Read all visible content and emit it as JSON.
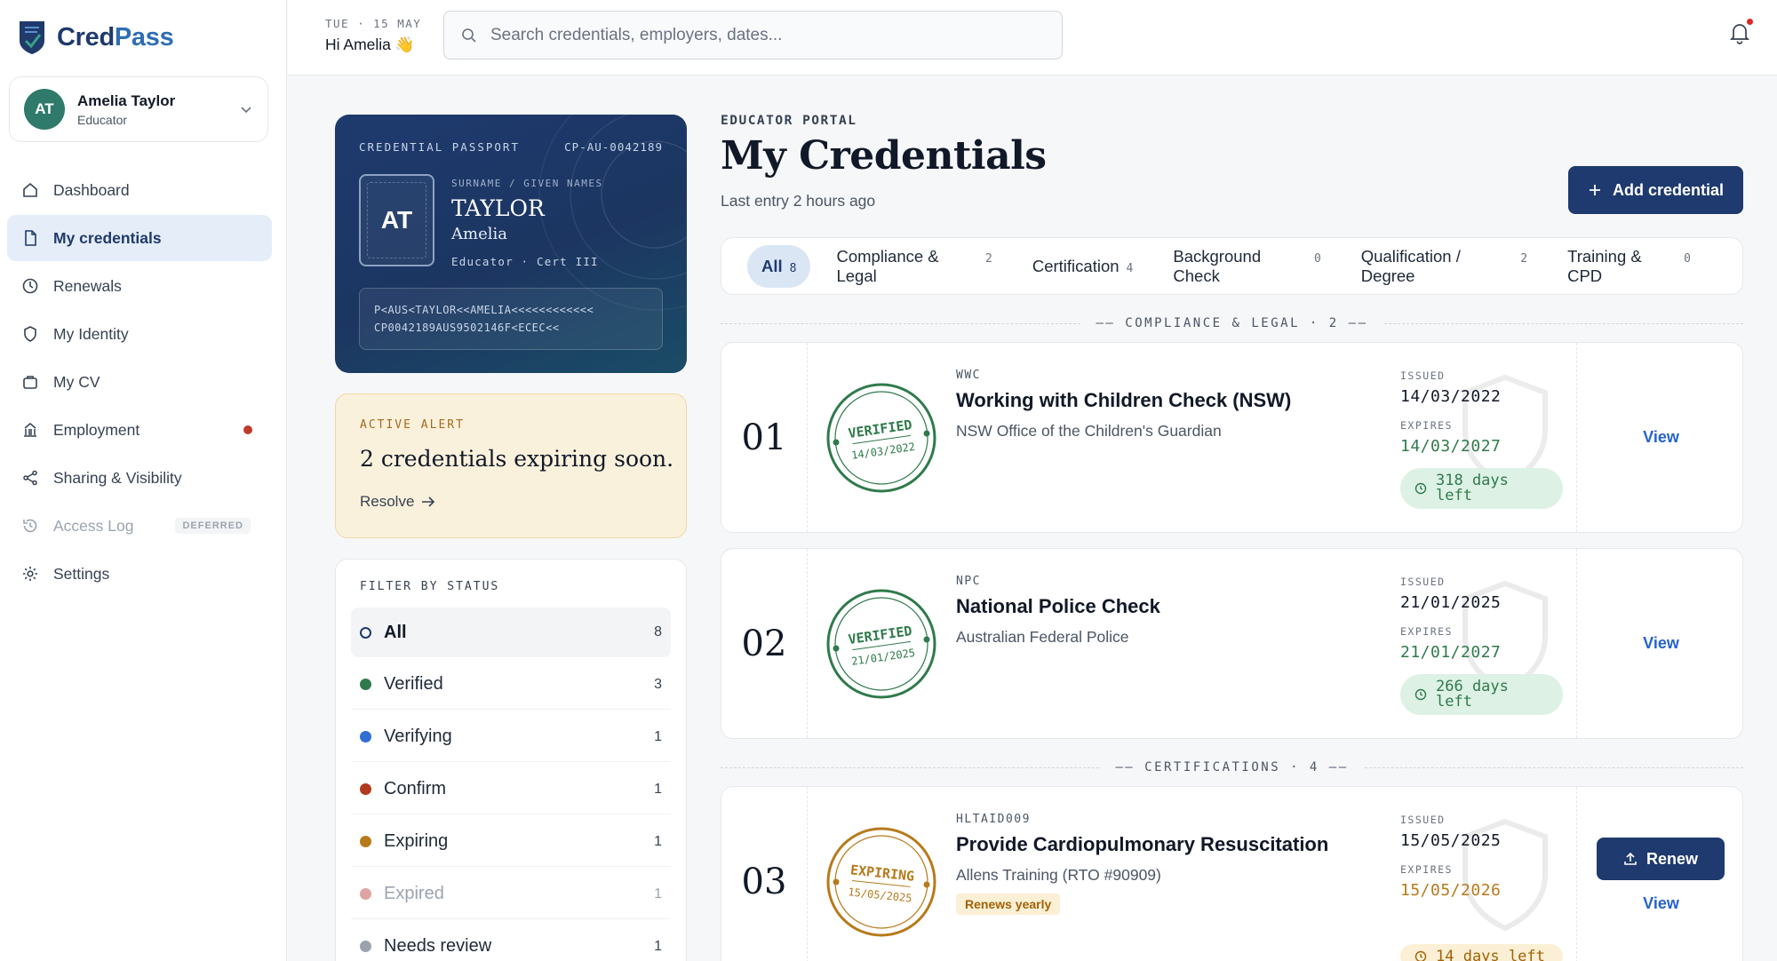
{
  "brand": {
    "name_a": "Cred",
    "name_b": "Pass"
  },
  "user": {
    "initials": "AT",
    "name": "Amelia Taylor",
    "role": "Educator"
  },
  "nav": {
    "dashboard": "Dashboard",
    "credentials": "My credentials",
    "renewals": "Renewals",
    "identity": "My Identity",
    "cv": "My CV",
    "employment": "Employment",
    "sharing": "Sharing & Visibility",
    "access_log": "Access Log",
    "deferred": "DEFERRED",
    "settings": "Settings"
  },
  "topbar": {
    "date": "TUE · 15 MAY",
    "greeting": "Hi Amelia 👋",
    "search_placeholder": "Search credentials, employers, dates..."
  },
  "passport": {
    "title": "CREDENTIAL PASSPORT",
    "id": "CP-AU-0042189",
    "initials": "AT",
    "names_label": "SURNAME / GIVEN NAMES",
    "surname": "TAYLOR",
    "given": "Amelia",
    "role_line": "Educator · Cert III",
    "mrz1": "P<AUS<TAYLOR<<AMELIA<<<<<<<<<<<<",
    "mrz2": "CP0042189AUS9502146F<ECEC<<"
  },
  "alert": {
    "tag": "ACTIVE ALERT",
    "title": "2 credentials expiring soon.",
    "link": "Resolve"
  },
  "filter": {
    "title": "FILTER BY STATUS",
    "items": [
      {
        "label": "All",
        "count": "8"
      },
      {
        "label": "Verified",
        "count": "3"
      },
      {
        "label": "Verifying",
        "count": "1"
      },
      {
        "label": "Confirm",
        "count": "1"
      },
      {
        "label": "Expiring",
        "count": "1"
      },
      {
        "label": "Expired",
        "count": "1"
      },
      {
        "label": "Needs review",
        "count": "1"
      }
    ]
  },
  "main": {
    "portal": "EDUCATOR PORTAL",
    "title": "My Credentials",
    "last_entry": "Last entry 2 hours ago",
    "add_button": "Add credential"
  },
  "tabs": [
    {
      "label": "All",
      "count": "8"
    },
    {
      "label": "Compliance & Legal",
      "count": "2"
    },
    {
      "label": "Certification",
      "count": "4"
    },
    {
      "label": "Background Check",
      "count": "0"
    },
    {
      "label": "Qualification / Degree",
      "count": "2"
    },
    {
      "label": "Training & CPD",
      "count": "0"
    }
  ],
  "sections": {
    "compliance": "—— COMPLIANCE & LEGAL · 2 ——",
    "certifications": "—— CERTIFICATIONS · 4 ——"
  },
  "labels": {
    "issued": "ISSUED",
    "expires": "EXPIRES",
    "view": "View",
    "renew": "Renew"
  },
  "credentials": [
    {
      "num": "01",
      "stamp": "VERIFIED",
      "stamp_date": "14/03/2022",
      "code": "WWC",
      "name": "Working with Children Check (NSW)",
      "issuer": "NSW Office of the Children's Guardian",
      "issued": "14/03/2022",
      "expires": "14/03/2027",
      "days": "318 days",
      "days_sub": "left"
    },
    {
      "num": "02",
      "stamp": "VERIFIED",
      "stamp_date": "21/01/2025",
      "code": "NPC",
      "name": "National Police Check",
      "issuer": "Australian Federal Police",
      "issued": "21/01/2025",
      "expires": "21/01/2027",
      "days": "266 days",
      "days_sub": "left"
    },
    {
      "num": "03",
      "stamp": "EXPIRING",
      "stamp_date": "15/05/2025",
      "code": "HLTAID009",
      "name": "Provide Cardiopulmonary Resuscitation",
      "issuer": "Allens Training (RTO #90909)",
      "badge": "Renews yearly",
      "issued": "15/05/2025",
      "expires": "15/05/2026",
      "days": "14 days left"
    }
  ],
  "colors": {
    "navy": "#1e3a6e",
    "green": "#2f7a4b",
    "amber": "#b77a1a",
    "status_verified": "#2f7a4b",
    "status_verifying": "#2f6fd6",
    "status_confirm": "#b23a1e",
    "status_expiring": "#b77a1a",
    "status_expired": "#e0a3a3",
    "status_review": "#9ca3af"
  }
}
